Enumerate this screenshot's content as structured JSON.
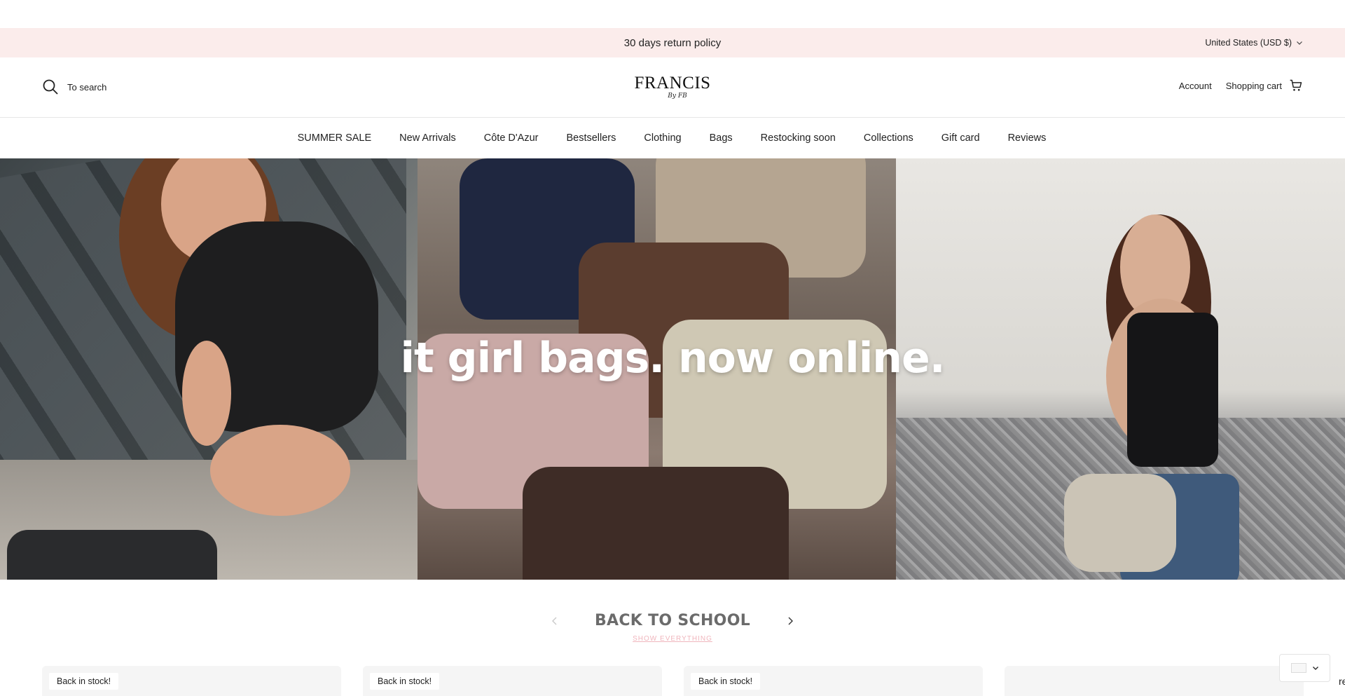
{
  "announcement": {
    "text": "30 days return policy"
  },
  "currency": {
    "label": "United States (USD $)",
    "icon": "chevron-down-icon"
  },
  "header": {
    "search_label": "To search",
    "logo_main": "FRANCIS",
    "logo_sub": "By FB",
    "account_label": "Account",
    "cart_label": "Shopping cart"
  },
  "nav": {
    "items": [
      {
        "label": "SUMMER SALE"
      },
      {
        "label": "New Arrivals"
      },
      {
        "label": "Côte D'Azur"
      },
      {
        "label": "Bestsellers"
      },
      {
        "label": "Clothing"
      },
      {
        "label": "Bags"
      },
      {
        "label": "Restocking soon"
      },
      {
        "label": "Collections"
      },
      {
        "label": "Gift card"
      },
      {
        "label": "Reviews"
      }
    ]
  },
  "hero": {
    "title": "it girl bags. now online."
  },
  "collection": {
    "title": "BACK TO SCHOOL",
    "show_all": "SHOW EVERYTHING"
  },
  "cards": [
    {
      "badge": "Back in stock!"
    },
    {
      "badge": "Back in stock!"
    },
    {
      "badge": "Back in stock!"
    },
    {
      "badge": ""
    }
  ],
  "edge_text": "re",
  "colors": {
    "announcement_bg": "#fbeceb",
    "show_all": "#f0b6bd"
  }
}
